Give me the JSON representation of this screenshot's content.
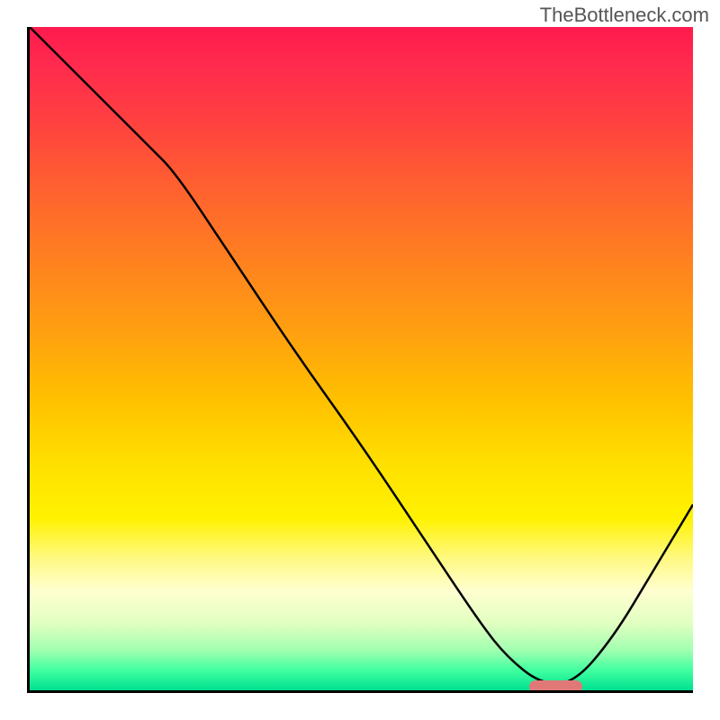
{
  "watermark": "TheBottleneck.com",
  "chart_data": {
    "type": "line",
    "title": "",
    "xlabel": "",
    "ylabel": "",
    "xlim": [
      0,
      100
    ],
    "ylim": [
      0,
      100
    ],
    "series": [
      {
        "name": "bottleneck-curve",
        "x": [
          0,
          10,
          18,
          22,
          30,
          40,
          50,
          60,
          68,
          72,
          77,
          82,
          88,
          94,
          100
        ],
        "y": [
          100,
          90,
          82,
          78,
          66,
          51,
          37,
          22,
          10,
          5,
          1,
          1,
          8,
          18,
          28
        ]
      }
    ],
    "marker": {
      "x_start": 75,
      "x_end": 83,
      "y": 1,
      "color": "#e07878"
    },
    "gradient_stops": [
      {
        "pos": 0,
        "color": "#ff1a4d"
      },
      {
        "pos": 6,
        "color": "#ff2b4d"
      },
      {
        "pos": 14,
        "color": "#ff4040"
      },
      {
        "pos": 24,
        "color": "#ff6030"
      },
      {
        "pos": 35,
        "color": "#ff8020"
      },
      {
        "pos": 46,
        "color": "#ffa010"
      },
      {
        "pos": 56,
        "color": "#ffc000"
      },
      {
        "pos": 66,
        "color": "#ffe000"
      },
      {
        "pos": 74,
        "color": "#fff200"
      },
      {
        "pos": 80,
        "color": "#fff980"
      },
      {
        "pos": 85,
        "color": "#ffffd0"
      },
      {
        "pos": 90,
        "color": "#e0ffc0"
      },
      {
        "pos": 94,
        "color": "#a0ffb0"
      },
      {
        "pos": 97,
        "color": "#40ffa0"
      },
      {
        "pos": 100,
        "color": "#00e090"
      }
    ]
  }
}
